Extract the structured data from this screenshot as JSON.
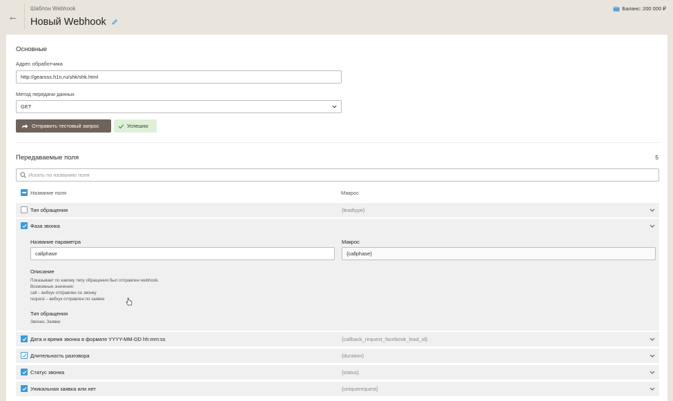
{
  "header": {
    "back_icon": "arrow-left-icon",
    "breadcrumb": "Шаблон Webhook",
    "title": "Новый Webhook",
    "edit_icon": "pencil-icon",
    "balance": "Баланс: 200 000 ₽",
    "balance_icon": "wallet-icon"
  },
  "basic": {
    "section_title": "Основные",
    "url_label": "Адрес обработчика",
    "url_value": "http://gearsss.h1n.ru/shk/shk.html",
    "method_label": "Метод передачи данных",
    "method_value": "GET",
    "test_button": "Отправить тестовый запрос",
    "success_badge": "Успешно"
  },
  "fields": {
    "section_title": "Передаваемые поля",
    "count": "5",
    "search_placeholder": "Искать по названию поля",
    "col_name": "Название поля",
    "col_macro": "Макрос",
    "rows": [
      {
        "name": "Тип обращения",
        "macro": "{leadtype}",
        "checked": false
      },
      {
        "name": "Фаза звонка",
        "macro": "",
        "checked": true
      },
      {
        "name": "Дата и время звонка в формате YYYY-MM-DD hh:mm:ss",
        "macro": "{callback_request_facebook_lead_id}",
        "checked": true
      },
      {
        "name": "Длительность разговора",
        "macro": "{duration}",
        "checked": true
      },
      {
        "name": "Статус звонка",
        "macro": "{status}",
        "checked": true
      },
      {
        "name": "Уникальная заявка или нет",
        "macro": "{uniquerequest}",
        "checked": true
      }
    ],
    "expanded": {
      "param_label": "Название параметра",
      "param_value": "callphase",
      "macro_label": "Макрос",
      "macro_value": "{callphase}",
      "desc_title": "Описание",
      "desc_lines": [
        "Показывает по какому типу обращения был отправлен webhook.",
        "Возможные значения:",
        "call – вебхук отправлен по звонку",
        "request – вебхук отправлен по заявке"
      ],
      "type_title": "Тип обращения",
      "type_value": "Звонки, Заявки"
    }
  },
  "colors": {
    "accent": "#3a9ad9",
    "button": "#6e625a",
    "success_bg": "#dff0d8",
    "success_icon": "#4a9a3a",
    "page_bg": "#e9e4dc"
  }
}
